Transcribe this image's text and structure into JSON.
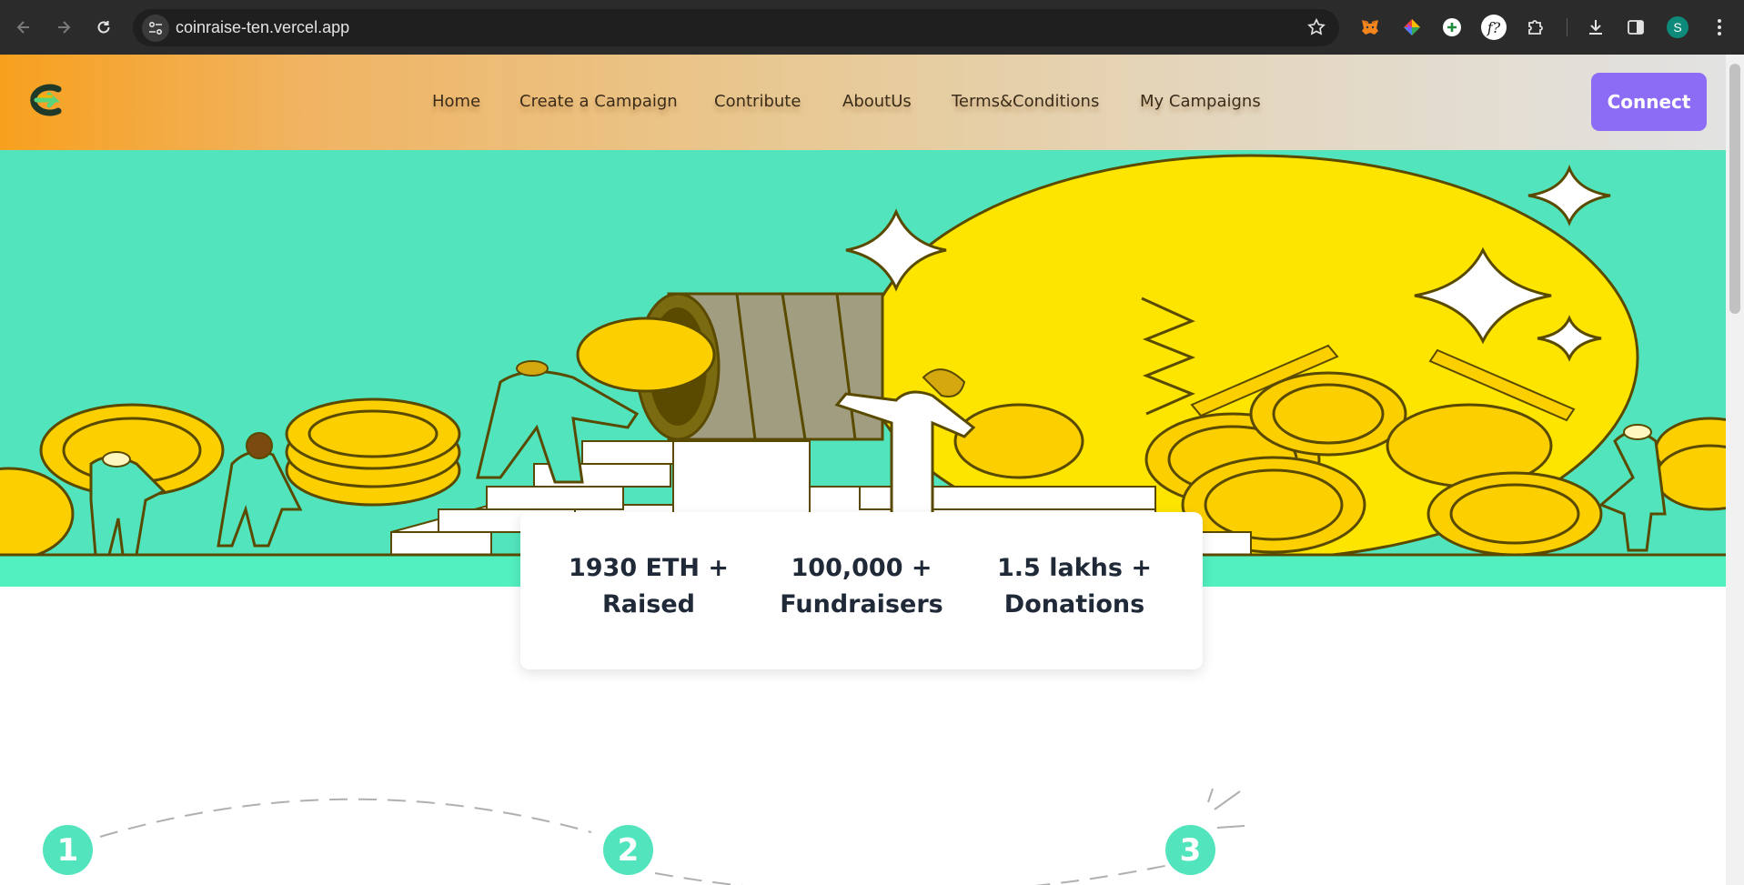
{
  "browser": {
    "url": "coinraise-ten.vercel.app",
    "profile_initial": "S",
    "extensions": [
      "metamask-icon",
      "color-picker-icon",
      "add-circle-icon",
      "function-icon",
      "puzzle-icon"
    ]
  },
  "nav": {
    "links": [
      "Home",
      "Create a Campaign",
      "Contribute",
      "AboutUs",
      "Terms&Conditions",
      "My Campaigns"
    ],
    "connect_label": "Connect"
  },
  "stats": [
    {
      "line1": "1930 ETH +",
      "line2": "Raised"
    },
    {
      "line1": "100,000 +",
      "line2": "Fundraisers"
    },
    {
      "line1": "1.5 lakhs +",
      "line2": "Donations"
    }
  ],
  "steps": [
    "1",
    "2",
    "3"
  ],
  "colors": {
    "accent": "#52e5bd",
    "connect_button": "#8c6cf5",
    "coin": "#fcd000",
    "nav_gradient_start": "#f7a01e"
  }
}
